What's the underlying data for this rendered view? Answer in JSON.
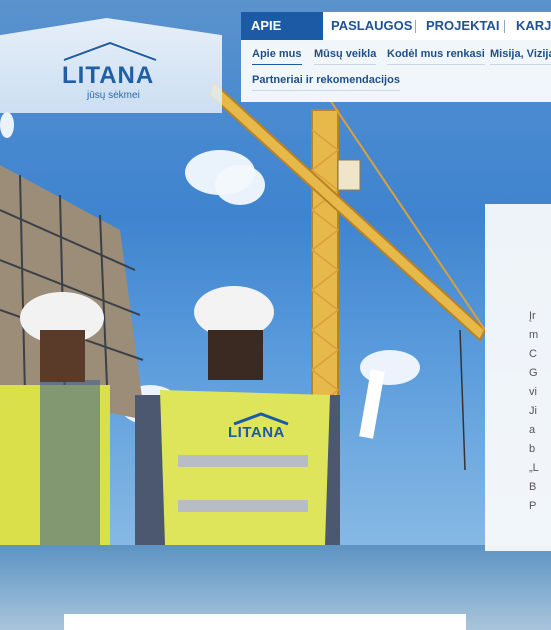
{
  "logo": {
    "name": "LITANA",
    "tagline": "jūsų sėkmei"
  },
  "nav": {
    "items": [
      {
        "label": "APIE MUS",
        "active": true
      },
      {
        "label": "PASLAUGOS",
        "active": false
      },
      {
        "label": "PROJEKTAI",
        "active": false
      },
      {
        "label": "KARJE",
        "active": false
      }
    ]
  },
  "submenu": {
    "items": [
      {
        "label": "Apie mus",
        "active": true
      },
      {
        "label": "Mūsų veikla",
        "active": false
      },
      {
        "label": "Kodėl mus renkasi",
        "active": false
      },
      {
        "label": "Misija, Vizija,",
        "active": false
      },
      {
        "label": "Partneriai ir rekomendacijos",
        "active": false
      }
    ]
  },
  "content": {
    "lines": [
      "Įr",
      "m",
      "C",
      "G",
      "vi",
      "Ji",
      "a",
      "b",
      "„L",
      "B",
      "P"
    ]
  },
  "vest": {
    "brand": "LITANA"
  },
  "colors": {
    "brand": "#1d5aa6",
    "nav_text": "#1f5294"
  }
}
